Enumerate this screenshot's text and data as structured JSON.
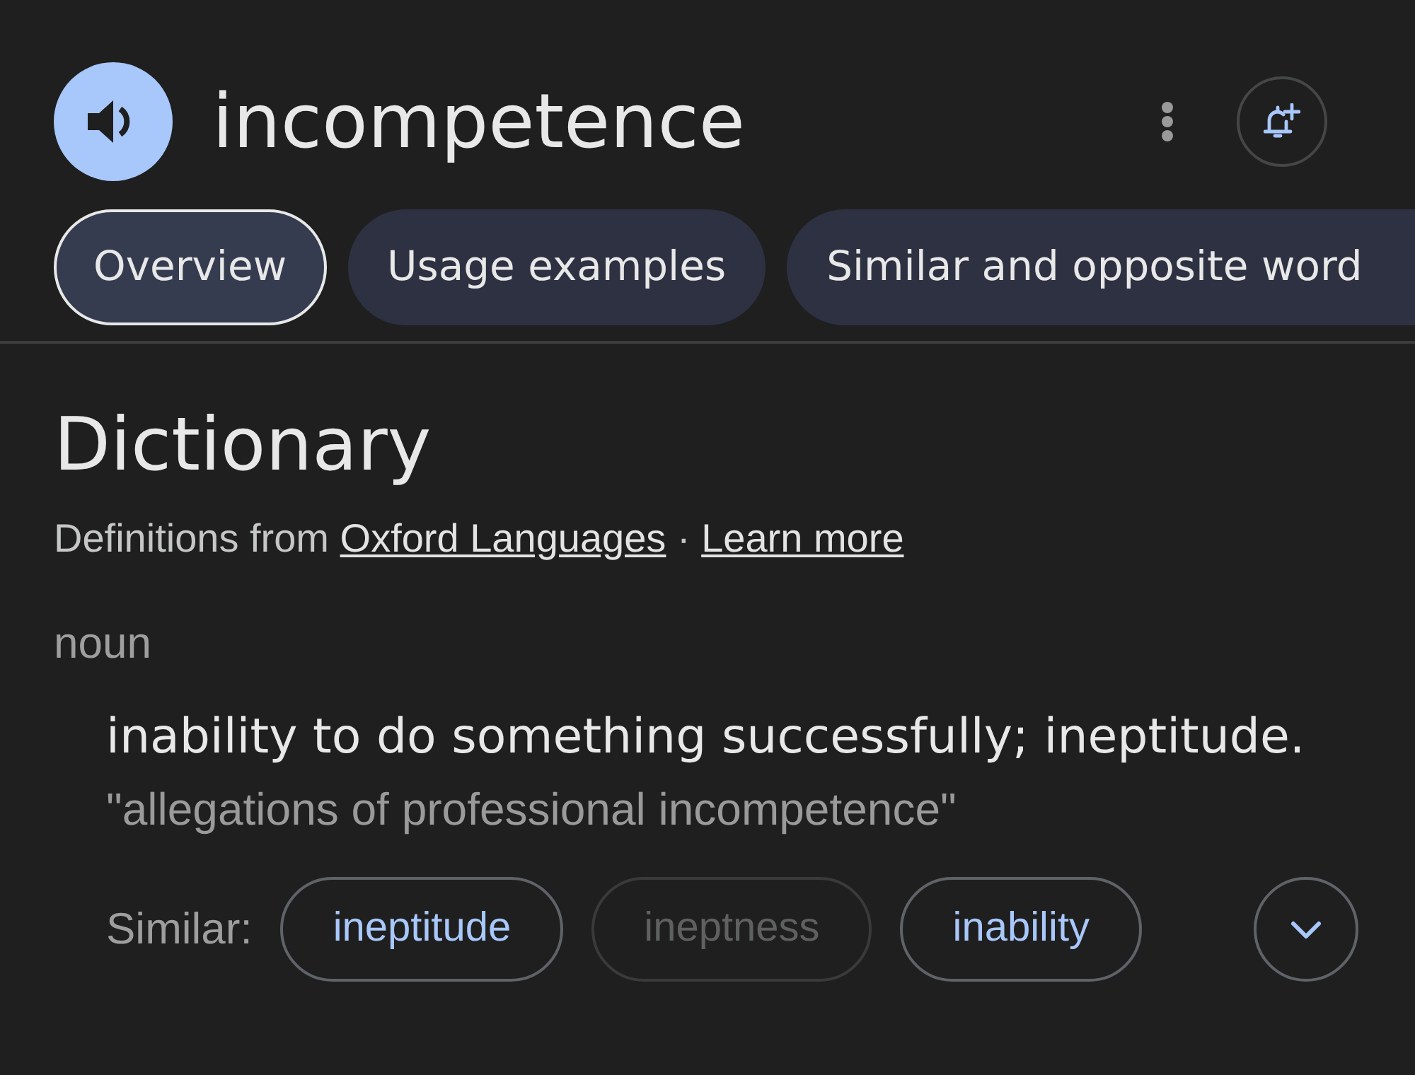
{
  "header": {
    "word": "incompetence"
  },
  "tabs": [
    {
      "label": "Overview",
      "selected": true
    },
    {
      "label": "Usage examples",
      "selected": false
    },
    {
      "label": "Similar and opposite word",
      "selected": false
    }
  ],
  "dictionary": {
    "title": "Dictionary",
    "source": {
      "prefix": "Definitions from",
      "link": "Oxford Languages",
      "separator": "·",
      "learn_more": "Learn more"
    }
  },
  "entry": {
    "part_of_speech": "noun",
    "definition": "inability to do something successfully; ineptitude.",
    "example": "\"allegations of professional incompetence\"",
    "similar": {
      "label": "Similar:",
      "words": [
        {
          "text": "ineptitude",
          "disabled": false
        },
        {
          "text": "ineptness",
          "disabled": true
        },
        {
          "text": "inability",
          "disabled": false
        }
      ]
    }
  }
}
